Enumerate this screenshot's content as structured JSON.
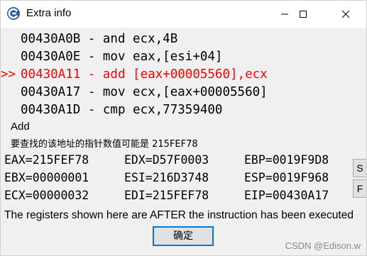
{
  "window": {
    "title": "Extra info",
    "controls": {
      "minimize_icon": "minimize-icon",
      "maximize_icon": "maximize-icon",
      "close_icon": "close-icon"
    }
  },
  "disassembly": [
    {
      "marker": "",
      "text": "00430A0B - and ecx,4B",
      "current": false
    },
    {
      "marker": "",
      "text": "00430A0E - mov eax,[esi+04]",
      "current": false
    },
    {
      "marker": ">>",
      "text": "00430A11 - add [eax+00005560],ecx",
      "current": true
    },
    {
      "marker": "",
      "text": "00430A17 - mov ecx,[eax+00005560]",
      "current": false
    },
    {
      "marker": "",
      "text": "00430A1D - cmp ecx,77359400",
      "current": false
    }
  ],
  "section_label": "Add",
  "pointer_note": "要查找的该地址的指针数值可能是 215FEF78",
  "registers": {
    "row1": [
      "EAX=215FEF78",
      "EDX=D57F0003",
      "EBP=0019F9D8"
    ],
    "row2": [
      "EBX=00000001",
      "ESI=216D3748",
      "ESP=0019F968"
    ],
    "row3": [
      "ECX=00000032",
      "EDI=215FEF78",
      "EIP=00430A17"
    ]
  },
  "side_buttons": {
    "s_label": "S",
    "f_label": "F"
  },
  "footer_text": "The registers shown here are AFTER the instruction has been executed",
  "ok_button_label": "确定",
  "watermark": "CSDN @Edison.w",
  "colors": {
    "current_line": "#ff0000",
    "focus_border": "#0078d7",
    "dialog_bg": "#f0f0f0"
  }
}
